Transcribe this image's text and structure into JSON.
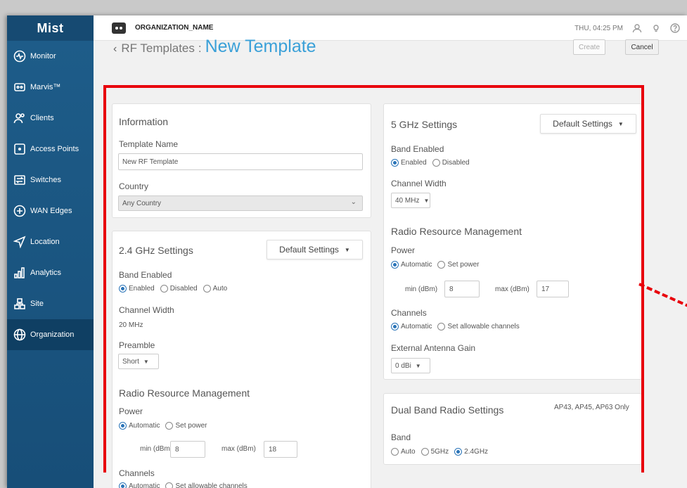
{
  "sidebar": {
    "logo": "Mist",
    "items": [
      {
        "label": "Monitor",
        "icon": "monitor-icon"
      },
      {
        "label": "Marvis™",
        "icon": "marvis-icon"
      },
      {
        "label": "Clients",
        "icon": "clients-icon"
      },
      {
        "label": "Access Points",
        "icon": "access-point-icon"
      },
      {
        "label": "Switches",
        "icon": "switch-icon"
      },
      {
        "label": "WAN Edges",
        "icon": "wan-edge-icon"
      },
      {
        "label": "Location",
        "icon": "location-icon"
      },
      {
        "label": "Analytics",
        "icon": "analytics-icon"
      },
      {
        "label": "Site",
        "icon": "site-icon"
      },
      {
        "label": "Organization",
        "icon": "globe-icon"
      }
    ],
    "active_index": 9
  },
  "topbar": {
    "org_name": "ORGANIZATION_NAME",
    "clock": "THU, 04:25 PM"
  },
  "header": {
    "parent": "RF Templates",
    "separator": ":",
    "current": "New Template",
    "create_label": "Create",
    "cancel_label": "Cancel"
  },
  "information": {
    "title": "Information",
    "template_name_label": "Template Name",
    "template_name_value": "New RF Template",
    "country_label": "Country",
    "country_value": "Any Country"
  },
  "band24": {
    "title": "2.4 GHz Settings",
    "dropdown": "Default Settings",
    "band_enabled_label": "Band Enabled",
    "band_options": [
      "Enabled",
      "Disabled",
      "Auto"
    ],
    "band_selected": 0,
    "channel_width_label": "Channel Width",
    "channel_width_value": "20 MHz",
    "preamble_label": "Preamble",
    "preamble_value": "Short",
    "rrm_title": "Radio Resource Management",
    "power_label": "Power",
    "power_options": [
      "Automatic",
      "Set power"
    ],
    "power_selected": 0,
    "min_label": "min (dBm)",
    "min_value": "8",
    "max_label": "max (dBm)",
    "max_value": "18",
    "channels_label": "Channels",
    "channels_options": [
      "Automatic",
      "Set allowable channels"
    ],
    "channels_selected": 0
  },
  "band5": {
    "title": "5 GHz Settings",
    "dropdown": "Default Settings",
    "band_enabled_label": "Band Enabled",
    "band_options": [
      "Enabled",
      "Disabled"
    ],
    "band_selected": 0,
    "channel_width_label": "Channel Width",
    "channel_width_value": "40 MHz",
    "rrm_title": "Radio Resource Management",
    "power_label": "Power",
    "power_options": [
      "Automatic",
      "Set power"
    ],
    "power_selected": 0,
    "min_label": "min (dBm)",
    "min_value": "8",
    "max_label": "max (dBm)",
    "max_value": "17",
    "channels_label": "Channels",
    "channels_options": [
      "Automatic",
      "Set allowable channels"
    ],
    "channels_selected": 0,
    "antenna_label": "External Antenna Gain",
    "antenna_value": "0 dBi"
  },
  "dual": {
    "title": "Dual Band Radio Settings",
    "note": "AP43, AP45, AP63 Only",
    "band_label": "Band",
    "band_options": [
      "Auto",
      "5GHz",
      "2.4GHz"
    ],
    "band_selected": 2
  },
  "colors": {
    "accent": "#3aa0d8",
    "sidebar": "#1e5d8a",
    "highlight": "#e8000b",
    "radio": "#2a74b8"
  }
}
